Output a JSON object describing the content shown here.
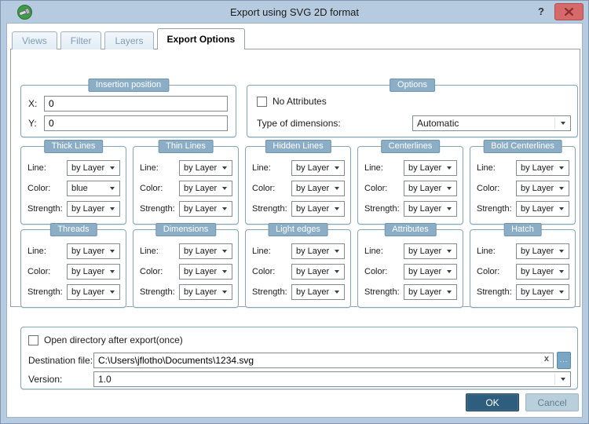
{
  "window": {
    "title": "Export using SVG 2D format",
    "help_label": "?",
    "close_label": "x"
  },
  "tabs": [
    {
      "label": "Views",
      "active": false
    },
    {
      "label": "Filter",
      "active": false
    },
    {
      "label": "Layers",
      "active": false
    },
    {
      "label": "Export Options",
      "active": true
    }
  ],
  "insertion": {
    "title": "Insertion position",
    "x_label": "X:",
    "x_value": "0",
    "y_label": "Y:",
    "y_value": "0"
  },
  "options": {
    "title": "Options",
    "no_attributes": {
      "label": "No Attributes",
      "checked": false
    },
    "type_of_dimensions": {
      "label": "Type of dimensions:",
      "value": "Automatic"
    }
  },
  "field_labels": {
    "line": "Line:",
    "color": "Color:",
    "strength": "Strength:"
  },
  "line_groups": [
    {
      "title": "Thick Lines",
      "line": "by Layer",
      "color": "blue",
      "strength": "by Layer"
    },
    {
      "title": "Thin Lines",
      "line": "by Layer",
      "color": "by Layer",
      "strength": "by Layer"
    },
    {
      "title": "Hidden Lines",
      "line": "by Layer",
      "color": "by Layer",
      "strength": "by Layer"
    },
    {
      "title": "Centerlines",
      "line": "by Layer",
      "color": "by Layer",
      "strength": "by Layer"
    },
    {
      "title": "Bold Centerlines",
      "line": "by Layer",
      "color": "by Layer",
      "strength": "by Layer"
    },
    {
      "title": "Threads",
      "line": "by Layer",
      "color": "by Layer",
      "strength": "by Layer"
    },
    {
      "title": "Dimensions",
      "line": "by Layer",
      "color": "by Layer",
      "strength": "by Layer"
    },
    {
      "title": "Light edges",
      "line": "by Layer",
      "color": "by Layer",
      "strength": "by Layer"
    },
    {
      "title": "Attributes",
      "line": "by Layer",
      "color": "by Layer",
      "strength": "by Layer"
    },
    {
      "title": "Hatch",
      "line": "by Layer",
      "color": "by Layer",
      "strength": "by Layer"
    }
  ],
  "footer": {
    "open_directory": {
      "label": "Open directory after export(once)",
      "checked": false
    },
    "destination": {
      "label": "Destination file:",
      "value": "C:\\Users\\jflotho\\Documents\\1234.svg",
      "clear_label": "x",
      "browse_label": "..."
    },
    "version": {
      "label": "Version:",
      "value": "1.0"
    }
  },
  "actions": {
    "ok": "OK",
    "cancel": "Cancel"
  },
  "colors": {
    "titlebar": "#b7cbe0",
    "frame_border": "#8196b3",
    "badge": "#8badc6",
    "group_border": "#87a5b8",
    "ok_button": "#2e5d7d",
    "cancel_button": "#b9cfdc",
    "close_button": "#d66a6a",
    "browse_button": "#7ba7c7"
  }
}
